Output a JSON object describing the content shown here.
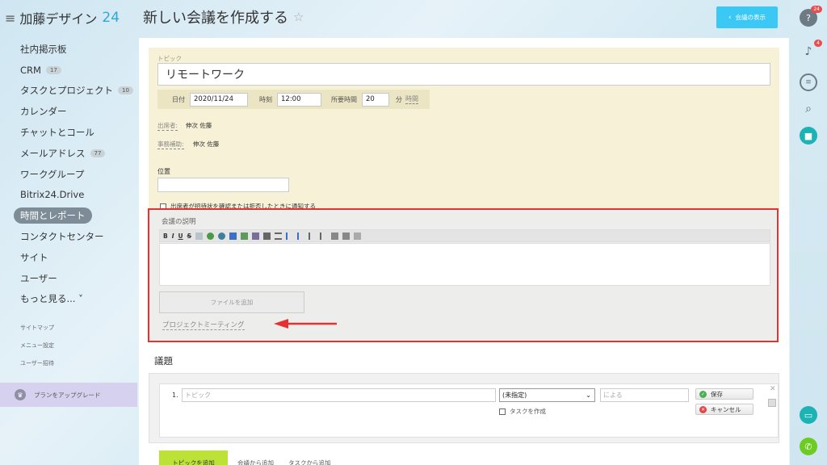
{
  "brand": {
    "name": "加藤デザイン",
    "number": "24"
  },
  "sidebar": {
    "items": [
      {
        "label": "社内掲示板"
      },
      {
        "label": "CRM",
        "badge": "17"
      },
      {
        "label": "タスクとプロジェクト",
        "badge": "10"
      },
      {
        "label": "カレンダー"
      },
      {
        "label": "チャットとコール"
      },
      {
        "label": "メールアドレス",
        "badge": "77"
      },
      {
        "label": "ワークグループ"
      },
      {
        "label": "Bitrix24.Drive"
      },
      {
        "label": "時間とレポート",
        "active": true
      },
      {
        "label": "コンタクトセンター"
      },
      {
        "label": "サイト"
      },
      {
        "label": "ユーザー"
      },
      {
        "label": "もっと見る... ˅"
      }
    ],
    "small_links": [
      "サイトマップ",
      "メニュー設定",
      "ユーザー招待"
    ],
    "upgrade_label": "プランをアップグレード"
  },
  "header": {
    "title": "新しい会議を作成する",
    "back_button": "会議の表示"
  },
  "rightbar": {
    "help_count": "24",
    "bell_count": "4"
  },
  "form": {
    "topic_label": "トピック",
    "topic_value": "リモートワーク",
    "date_label": "日付",
    "date_value": "2020/11/24",
    "time_label": "時刻",
    "time_value": "12:00",
    "duration_label": "所要時間",
    "duration_value": "20",
    "duration_unit": "分",
    "duration_unit_link": "時間",
    "attendees_label": "出席者:",
    "attendees_value": "伸次 佐藤",
    "assistant_label": "事務補助:",
    "assistant_value": "伸次 佐藤",
    "location_label": "位置",
    "location_value": "",
    "notify_label": "出席者が招待状を確認または拒否したときに通知する"
  },
  "description": {
    "label": "会議の説明",
    "toolbar": [
      "B",
      "I",
      "U",
      "S"
    ],
    "add_file_button": "ファイルを追加",
    "project_tag": "プロジェクトミーティング"
  },
  "agenda": {
    "title": "議題",
    "row_number": "1.",
    "topic_placeholder": "トピック",
    "select_value": "(未指定)",
    "by_placeholder": "による",
    "save_button": "保存",
    "cancel_button": "キャンセル",
    "create_task_label": "タスクを作成",
    "add_topic_button": "トピックを追加",
    "add_from_meeting": "会議から追加",
    "add_from_task": "タスクから追加"
  },
  "colors": {
    "accent_blue": "#3bc8f5",
    "highlight_red": "#e53131",
    "add_green": "#bde237"
  }
}
